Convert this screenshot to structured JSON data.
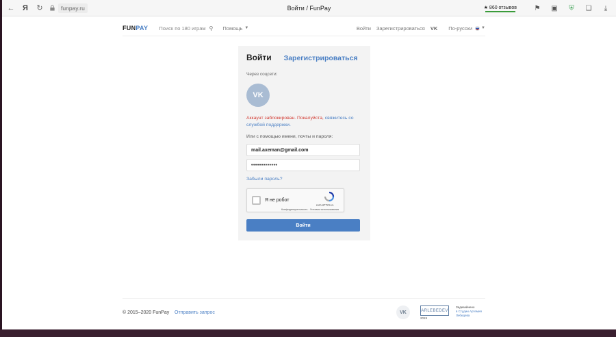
{
  "browser": {
    "back_icon": "arrow-left-icon",
    "yandex_icon": "yandex-logo",
    "reload_icon": "reload-icon",
    "url": "funpay.ru",
    "title": "Войти / FunPay",
    "reviews": "★ 860 отзывов"
  },
  "nav": {
    "logo_part1": "FUN",
    "logo_part2": "PAY",
    "search_placeholder": "Поиск по 180 играм",
    "help": "Помощь",
    "login": "Войти",
    "register": "Зарегистрироваться",
    "vk": "VK",
    "language": "По-русски"
  },
  "login": {
    "tab_login": "Войти",
    "tab_register": "Зарегистрироваться",
    "social_label": "Через соцсети:",
    "vk_button": "VK",
    "error_text": "Аккаунт заблокирован. Покалуйста, ",
    "error_link": "свяжитесь со службой поддержки.",
    "or_label": "Или с помощью имени, почты и пароля:",
    "email_value": "mail.axeman@gmail.com",
    "password_value": "•••••••••••••",
    "forgot": "Забыли пароль?",
    "captcha_label": "Я не робот",
    "captcha_brand": "reCAPTCHA",
    "captcha_terms": "Конфиденциальность - Условия использования",
    "submit": "Войти"
  },
  "footer": {
    "copyright": "© 2015–2020 FunPay",
    "feedback": "Отправить запрос",
    "vk": "VK",
    "studio_logo": "ARLEBEDEV",
    "studio_year": "2019",
    "studio_line1": "Задизайнено",
    "studio_line2": "в Студии Артемия Лебедева"
  },
  "colors": {
    "accent": "#4a7fc4",
    "error": "#d23a32",
    "card_bg": "#f3f3f3"
  }
}
